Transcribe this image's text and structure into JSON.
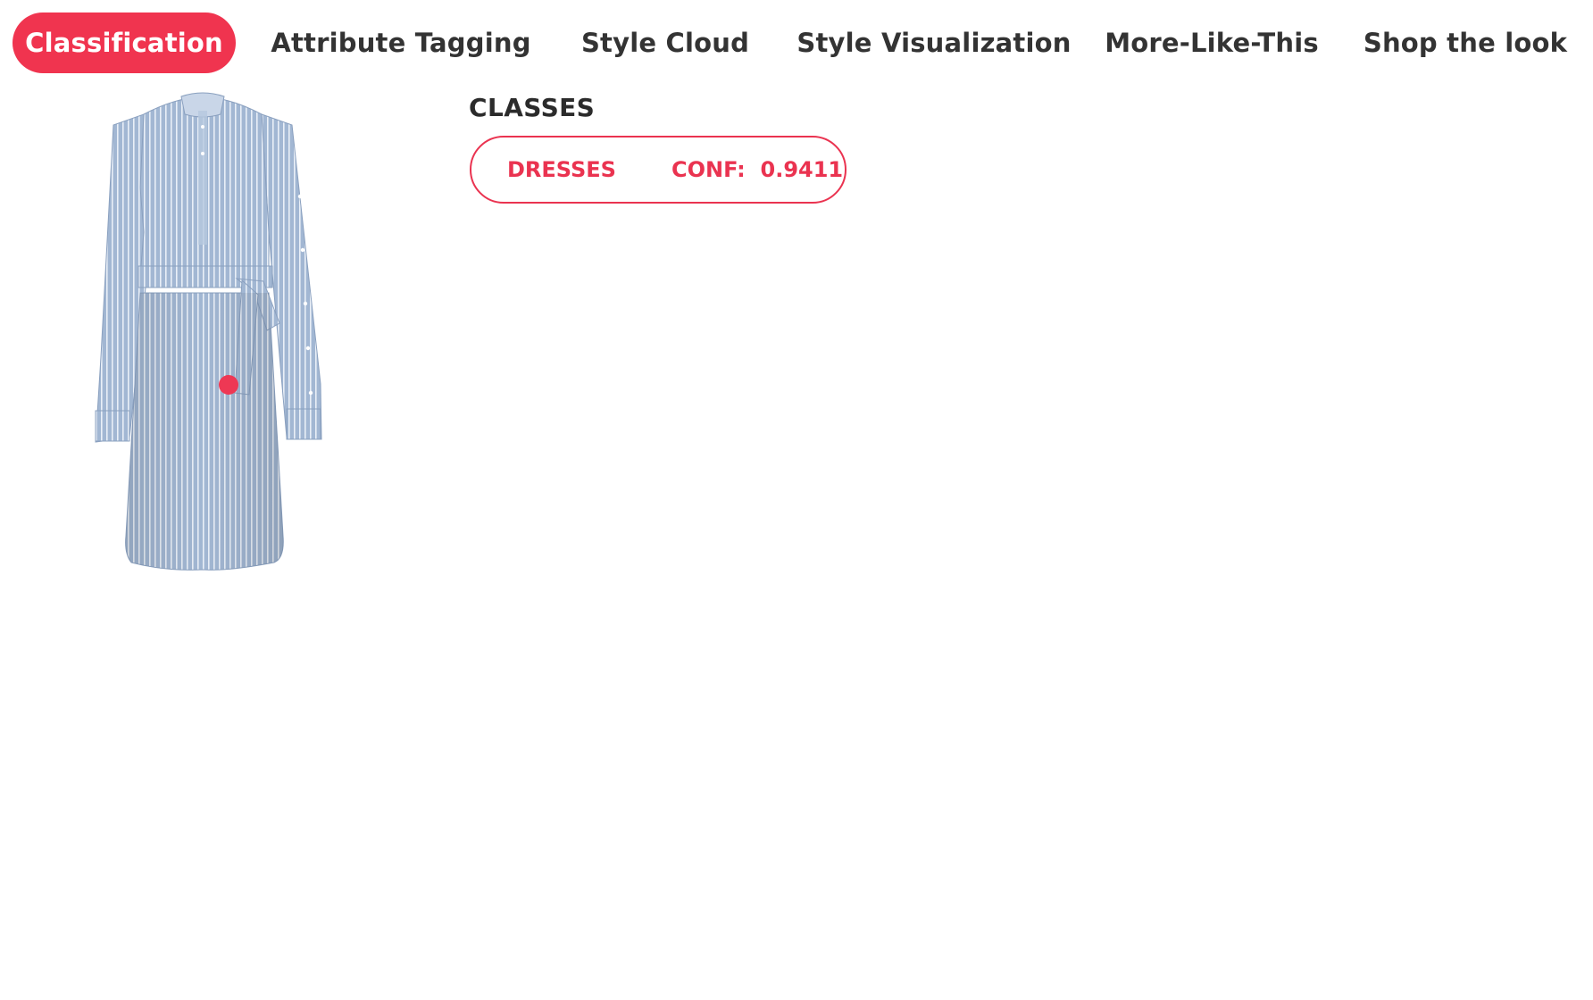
{
  "tabs": [
    {
      "label": "Classification",
      "active": true
    },
    {
      "label": "Attribute Tagging",
      "active": false
    },
    {
      "label": "Style Cloud",
      "active": false
    },
    {
      "label": "Style Visualization",
      "active": false
    },
    {
      "label": "More-Like-This",
      "active": false
    },
    {
      "label": "Shop the look",
      "active": false
    }
  ],
  "classes": {
    "heading": "CLASSES",
    "items": [
      {
        "name": "DRESSES",
        "conf_label": "CONF:",
        "conf_value": "0.9411"
      }
    ]
  },
  "product": {
    "image_icon": "striped-shirt-dress-image",
    "hotspot_icon": "hotspot-dot-icon"
  },
  "colors": {
    "accent": "#f0344f",
    "dress_base": "#9db3d0",
    "dress_stripe": "#e8eef6",
    "text": "#333333"
  }
}
